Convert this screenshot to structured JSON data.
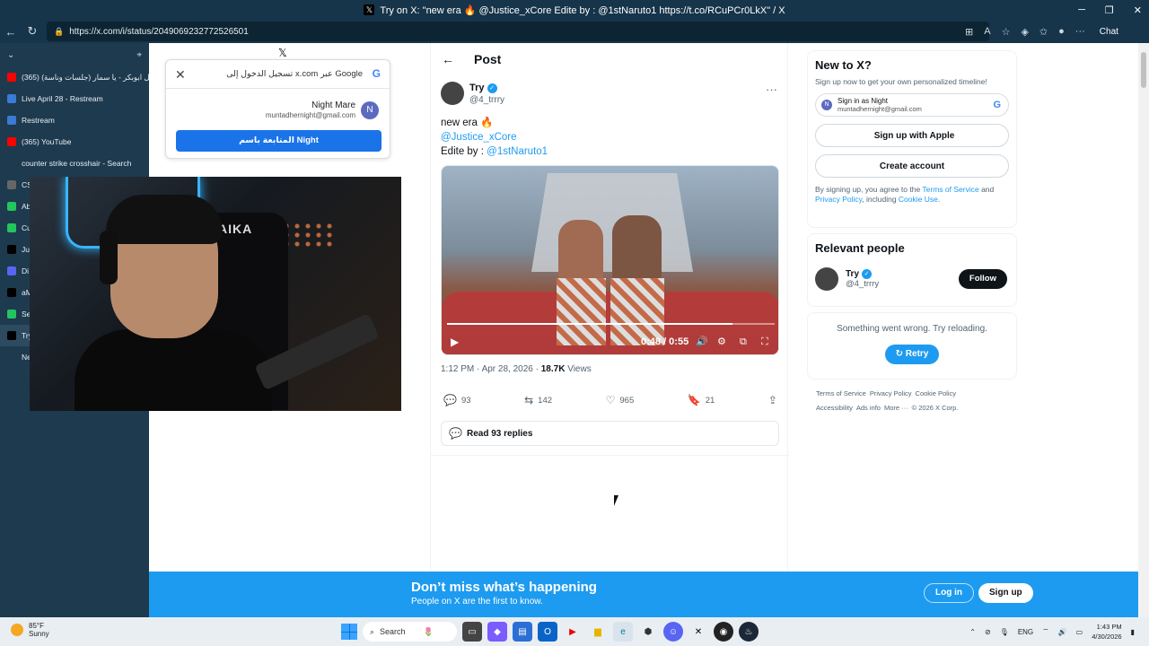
{
  "window": {
    "title": "Try on X: \"new era 🔥 @Justice_xCore Edite by : @1stNaruto1 https://t.co/RCuPCr0LkX\" / X",
    "url": "https://x.com/i/status/2049069232772526501"
  },
  "browser": {
    "chat_label": "Chat"
  },
  "sidebar": {
    "tabs": [
      {
        "label": "(365) اصيل ابوبكر - يا سمار (جلسات وناسة)",
        "icon_color": "#ff0000"
      },
      {
        "label": "Live April 28 - Restream",
        "icon_color": "#3a7bd5"
      },
      {
        "label": "Restream",
        "icon_color": "#3a7bd5"
      },
      {
        "label": "(365) YouTube",
        "icon_color": "#ff0000"
      },
      {
        "label": "counter strike crosshair - Search",
        "icon_color": "#1e3a4e"
      },
      {
        "label": "CS",
        "icon_color": "#666666"
      },
      {
        "label": "Ab",
        "icon_color": "#22c55e"
      },
      {
        "label": "Cu",
        "icon_color": "#22c55e"
      },
      {
        "label": "Ju",
        "icon_color": "#000000"
      },
      {
        "label": "Di",
        "icon_color": "#5865f2"
      },
      {
        "label": "aM",
        "icon_color": "#000000"
      },
      {
        "label": "Se",
        "icon_color": "#22c55e"
      },
      {
        "label": "Try",
        "icon_color": "#000000"
      },
      {
        "label": "Ne",
        "icon_color": "#1e3a4e"
      }
    ]
  },
  "webcam": {
    "chair_brand": "AIKA"
  },
  "google_popup": {
    "title": "تسجيل الدخول إلى x.com عبر Google",
    "account_name": "Night Mare",
    "account_email": "muntadhernight@gmail.com",
    "avatar_letter": "N",
    "continue_label": "المتابعة باسم Night"
  },
  "post": {
    "header_title": "Post",
    "author_name": "Try",
    "author_handle": "@4_trrry",
    "text_line1": "new era 🔥",
    "mention1": "@Justice_xCore",
    "text_line3_prefix": "Edite by : ",
    "mention2": "@1stNaruto1",
    "video": {
      "time": "0:48 / 0:55",
      "progress": 0.87
    },
    "timestamp": "1:12 PM · Apr 28, 2026 · ",
    "views_count": "18.7K",
    "views_label": " Views",
    "replies": "93",
    "reposts": "142",
    "likes": "965",
    "bookmarks": "21",
    "read_replies_label": "Read 93 replies"
  },
  "right": {
    "newx_title": "New to X?",
    "newx_sub": "Sign up now to get your own personalized timeline!",
    "google_signin_name": "Sign in as Night",
    "google_signin_email": "muntadhernight@gmail.com",
    "apple_label": "Sign up with Apple",
    "create_label": "Create account",
    "terms_prefix": "By signing up, you agree to the ",
    "terms_link": "Terms of Service",
    "terms_and": " and ",
    "privacy_link": "Privacy Policy",
    "terms_including": ", including ",
    "cookie_link": "Cookie Use",
    "terms_end": ".",
    "relevant_title": "Relevant people",
    "rel_name": "Try",
    "rel_handle": "@4_trrry",
    "follow_label": "Follow",
    "error_msg": "Something went wrong. Try reloading.",
    "retry_label": "Retry",
    "footer": [
      "Terms of Service",
      "Privacy Policy",
      "Cookie Policy",
      "Accessibility",
      "Ads info",
      "More ···",
      "© 2026 X Corp."
    ]
  },
  "banner": {
    "title": "Don’t miss what’s happening",
    "subtitle": "People on X are the first to know.",
    "login_label": "Log in",
    "signup_label": "Sign up"
  },
  "taskbar": {
    "temp": "85°F",
    "weather": "Sunny",
    "search_label": "Search",
    "lang": "ENG",
    "time": "1:43 PM",
    "date": "4/30/2026"
  }
}
